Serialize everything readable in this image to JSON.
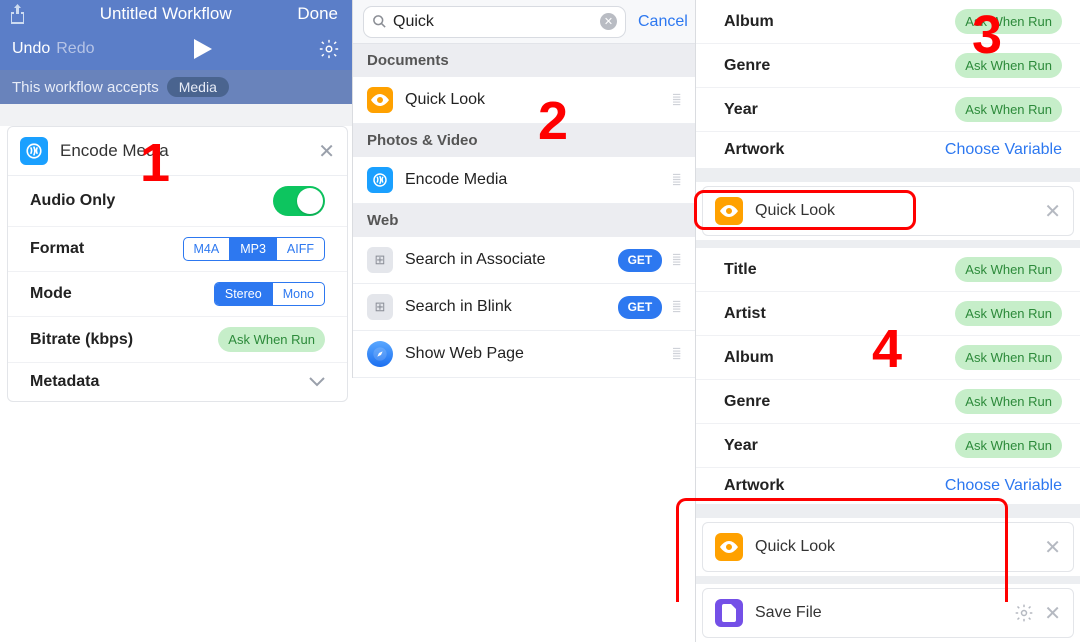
{
  "annotations": {
    "n1": "1",
    "n2": "2",
    "n3": "3",
    "n4": "4"
  },
  "panel1": {
    "title": "Untitled Workflow",
    "done": "Done",
    "undo": "Undo",
    "redo": "Redo",
    "accepts_text": "This workflow accepts",
    "accepts_pill": "Media",
    "card_title": "Encode Media",
    "rows": {
      "audio_only": "Audio Only",
      "format": "Format",
      "format_opts": {
        "m4a": "M4A",
        "mp3": "MP3",
        "aiff": "AIFF"
      },
      "mode": "Mode",
      "mode_opts": {
        "stereo": "Stereo",
        "mono": "Mono"
      },
      "bitrate": "Bitrate (kbps)",
      "ask": "Ask When Run",
      "metadata": "Metadata"
    }
  },
  "panel2": {
    "query": "Quick",
    "cancel": "Cancel",
    "sec_docs": "Documents",
    "quick_look": "Quick Look",
    "sec_photos": "Photos & Video",
    "encode_media": "Encode Media",
    "sec_web": "Web",
    "search_associate": "Search in Associate",
    "search_blink": "Search in Blink",
    "get": "GET",
    "show_web": "Show Web Page"
  },
  "panel3": {
    "rows_top": {
      "album": "Album",
      "genre": "Genre",
      "year": "Year",
      "artwork": "Artwork"
    },
    "rows_mid": {
      "title": "Title",
      "artist": "Artist",
      "album": "Album",
      "genre": "Genre",
      "year": "Year",
      "artwork": "Artwork"
    },
    "ask": "Ask When Run",
    "choose_var": "Choose Variable",
    "quick_look": "Quick Look",
    "save_file": "Save File"
  }
}
